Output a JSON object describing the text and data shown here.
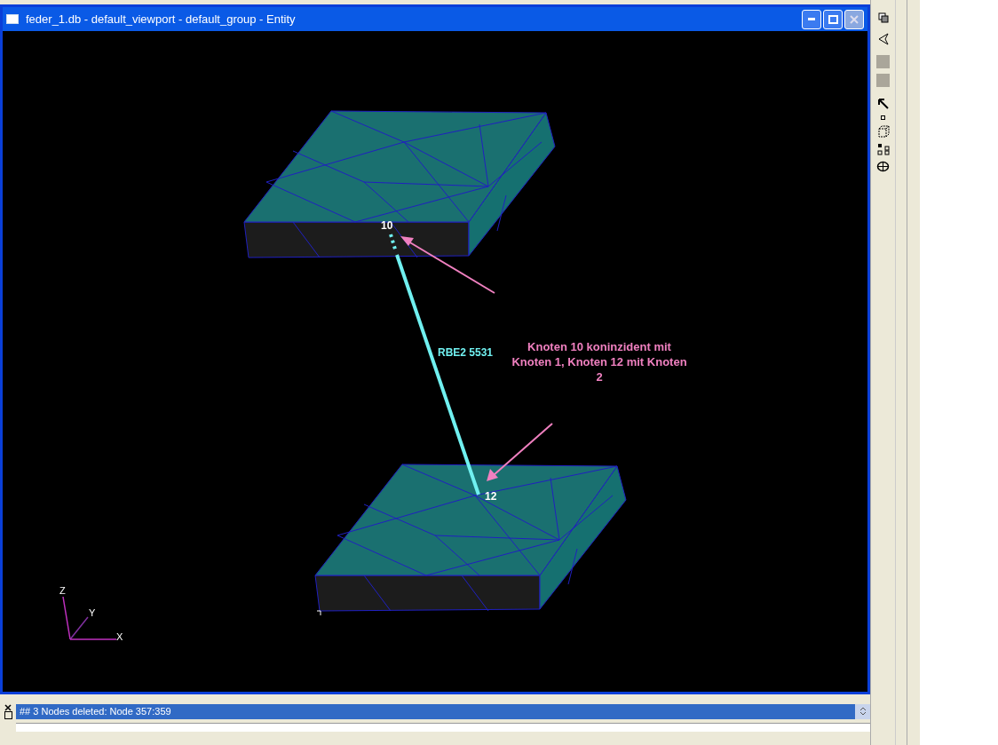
{
  "window": {
    "title": "feder_1.db - default_viewport - default_group - Entity"
  },
  "viewport": {
    "node_labels": [
      "10",
      "12"
    ],
    "element_label": "RBE2 5531",
    "annotation": "Knoten 10 koninzident mit Knoten 1, Knoten 12 mit Knoten 2",
    "axes": [
      "Z",
      "Y",
      "X"
    ]
  },
  "status_bar": {
    "message": "## 3 Nodes deleted: Node 357:359"
  }
}
